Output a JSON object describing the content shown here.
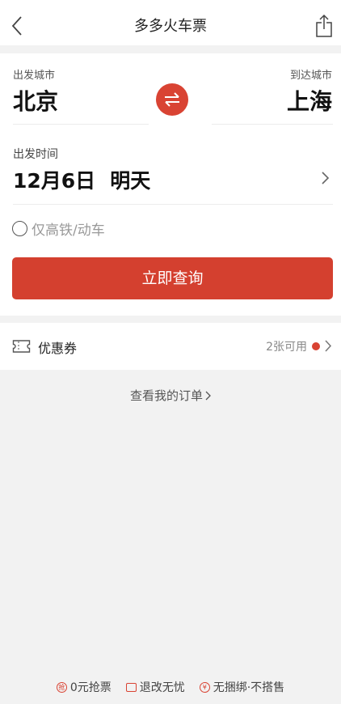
{
  "nav": {
    "title": "多多火车票",
    "back_icon": "chevron-left-icon",
    "share_icon": "share-icon"
  },
  "route": {
    "from_label": "出发城市",
    "from_city": "北京",
    "to_label": "到达城市",
    "to_city": "上海",
    "swap_icon": "swap-arrows-icon",
    "swap_color": "#d94333"
  },
  "date": {
    "label": "出发时间",
    "value": "12月6日",
    "relative": "明天"
  },
  "filter": {
    "label": "仅高铁/动车",
    "checked": false
  },
  "query_button": {
    "label": "立即查询",
    "color": "#d4402f"
  },
  "coupon": {
    "label": "优惠券",
    "availability": "2张可用",
    "icon": "ticket-icon"
  },
  "orders": {
    "label": "查看我的订单"
  },
  "footer": [
    {
      "icon_char": "抢",
      "label": "0元抢票"
    },
    {
      "icon_char": "",
      "label": "退改无忧"
    },
    {
      "icon_char": "¥",
      "label": "无捆绑·不搭售"
    }
  ]
}
